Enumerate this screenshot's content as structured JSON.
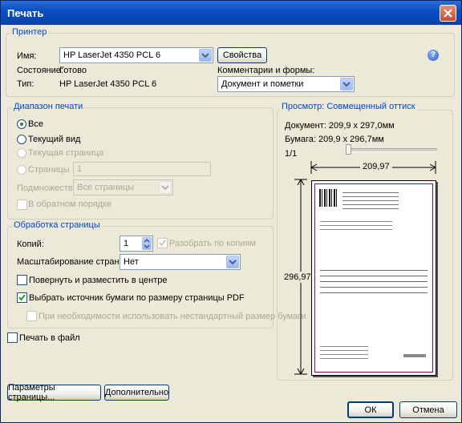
{
  "window": {
    "title": "Печать"
  },
  "printer": {
    "group_label": "Принтер",
    "name_label": "Имя:",
    "name_value": "HP LaserJet 4350 PCL 6",
    "properties_button": "Свойства",
    "status_label": "Состояние:",
    "status_value": "Готово",
    "type_label": "Тип:",
    "type_value": "HP LaserJet 4350 PCL 6",
    "comments_label": "Комментарии и формы:",
    "comments_value": "Документ и пометки"
  },
  "range": {
    "group_label": "Диапазон печати",
    "all": "Все",
    "current_view": "Текущий вид",
    "current_page": "Текущая страница",
    "pages": "Страницы",
    "pages_value": "1",
    "subset_label": "Подмножество:",
    "subset_value": "Все страницы",
    "reverse": "В обратном порядке"
  },
  "handling": {
    "group_label": "Обработка страницы",
    "copies_label": "Копий:",
    "copies_value": "1",
    "collate": "Разобрать по копиям",
    "scaling_label": "Масштабирование страницы:",
    "scaling_value": "Нет",
    "auto_rotate": "Повернуть и разместить в центре",
    "choose_source": "Выбрать источник бумаги по размеру страницы PDF",
    "custom_paper": "При необходимости использовать нестандартный размер бумаги"
  },
  "print_to_file": "Печать в файл",
  "preview": {
    "group_label": "Просмотр: Совмещенный оттиск",
    "document": "Документ: 209,9 x 297,0мм",
    "paper": "Бумага: 209,9 x 296,7мм",
    "page_counter": "1/1",
    "width_label": "209,97",
    "height_label": "296,97"
  },
  "buttons": {
    "page_setup": "Параметры страницы...",
    "advanced": "Дополнительно",
    "ok": "ОК",
    "cancel": "Отмена"
  },
  "colors": {
    "title_bar": "#0a4fc4",
    "group_label": "#0046d5",
    "dialog_bg": "#ece9d8"
  },
  "icons": [
    "close-icon",
    "help-icon",
    "chevron-down-icon",
    "spinner-icon",
    "checkmark-icon",
    "slider-thumb-icon"
  ]
}
